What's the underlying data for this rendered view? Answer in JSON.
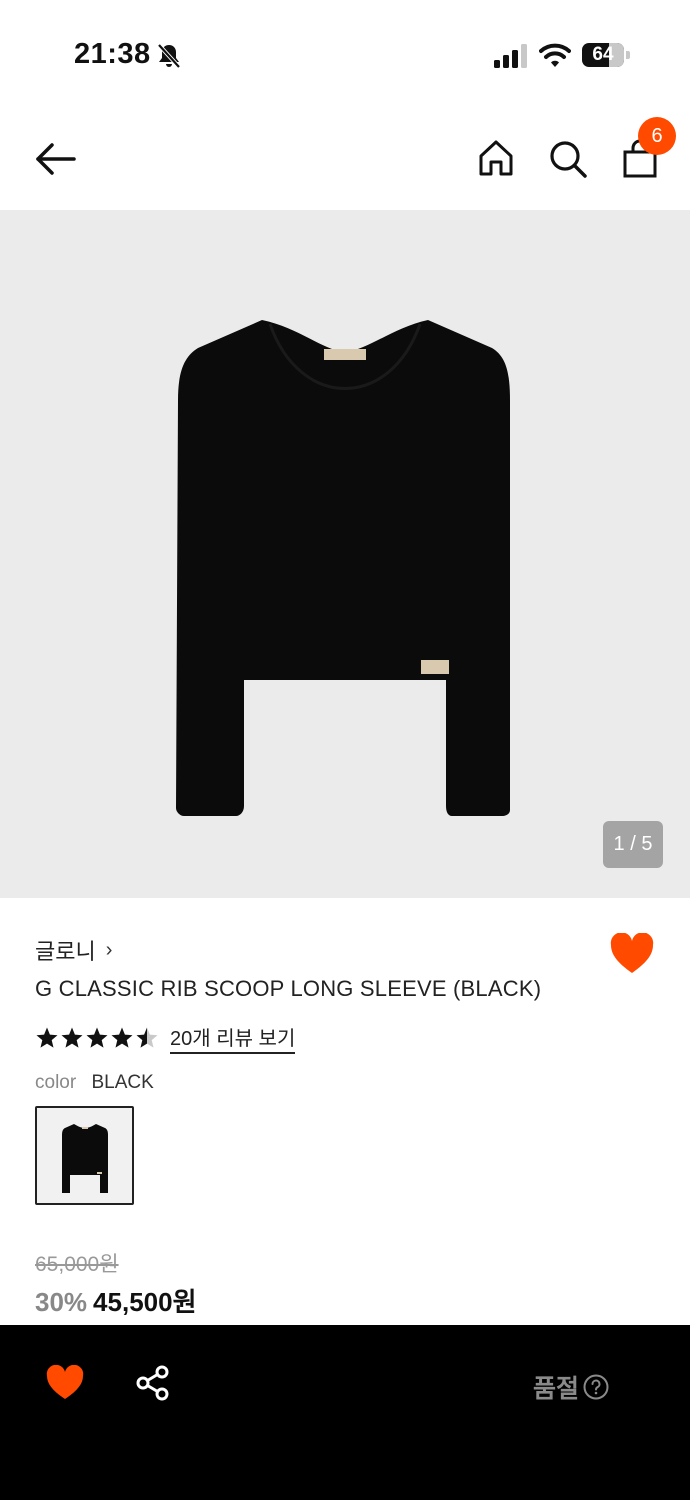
{
  "status_bar": {
    "time": "21:38",
    "battery": "64",
    "battery_level": 0.64,
    "icons": [
      "bell-off-icon",
      "signal-icon",
      "wifi-icon",
      "battery-icon"
    ]
  },
  "nav": {
    "icons": [
      "back-arrow-icon",
      "home-icon",
      "search-icon",
      "shopping-bag-icon"
    ],
    "cart_count": "6"
  },
  "gallery": {
    "indicator": "1 / 5",
    "current": 1,
    "total": 5
  },
  "product": {
    "brand": "글로니",
    "brand_chevron": "›",
    "name": "G CLASSIC RIB SCOOP LONG SLEEVE (BLACK)",
    "rating": 4.5,
    "review_link": "20개 리뷰 보기",
    "color_label": "color",
    "color_value": "BLACK",
    "original_price": "65,000원",
    "discount": "30%",
    "sale_price": "45,500원"
  },
  "bottom_bar": {
    "soldout_label": "품절",
    "icons": [
      "heart-icon",
      "share-icon",
      "help-circle-icon"
    ]
  },
  "colors": {
    "accent": "#ff4a00",
    "image_bg": "#ebebeb",
    "bottom_bar_bg": "#000000",
    "indicator_bg": "#a4a4a4"
  }
}
